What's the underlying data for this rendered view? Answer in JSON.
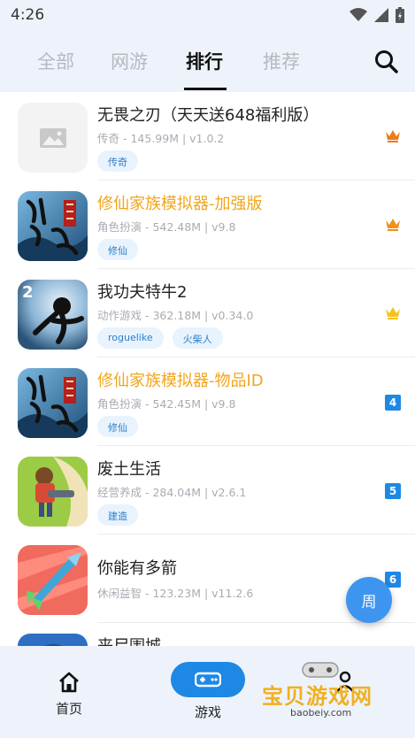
{
  "status_bar": {
    "time": "4:26"
  },
  "tabs": [
    {
      "label": "全部",
      "active": false
    },
    {
      "label": "网游",
      "active": false
    },
    {
      "label": "排行",
      "active": true
    },
    {
      "label": "推荐",
      "active": false
    }
  ],
  "apps": [
    {
      "name": "无畏之刃（天天送648福利版）",
      "meta": "传奇 - 145.99M | v1.0.2",
      "tags": [
        "传奇"
      ],
      "rank": "crown",
      "highlight": false,
      "icon": "image-placeholder-icon"
    },
    {
      "name": "修仙家族模拟器-加强版",
      "meta": "角色扮演 - 542.48M | v9.8",
      "tags": [
        "修仙"
      ],
      "rank": "crown",
      "highlight": true,
      "icon": "xiuxian-game-icon"
    },
    {
      "name": "我功夫特牛2",
      "meta": "动作游戏 - 362.18M | v0.34.0",
      "tags": [
        "roguelike",
        "火柴人"
      ],
      "rank": "crown",
      "highlight": false,
      "icon": "kungfu-game-icon"
    },
    {
      "name": "修仙家族模拟器-物品ID",
      "meta": "角色扮演 - 542.45M | v9.8",
      "tags": [
        "修仙"
      ],
      "rank": "4",
      "highlight": true,
      "icon": "xiuxian-game-icon"
    },
    {
      "name": "废土生活",
      "meta": "经营养成 - 284.04M | v2.6.1",
      "tags": [
        "建造"
      ],
      "rank": "5",
      "highlight": false,
      "icon": "wasteland-game-icon"
    },
    {
      "name": "你能有多箭",
      "meta": "休闲益智 - 123.23M | v11.2.6",
      "tags": [],
      "rank": "6",
      "highlight": false,
      "icon": "arrow-game-icon"
    },
    {
      "name": "丧尸围城",
      "meta": "",
      "tags": [],
      "rank": "",
      "highlight": false,
      "icon": "zombie-game-icon"
    }
  ],
  "fab": {
    "label": "周"
  },
  "nav": {
    "home": "首页",
    "games": "游戏"
  },
  "watermark": {
    "text": "宝贝游戏网",
    "url": "baobeiy.com"
  },
  "colors": {
    "accent": "#1e88e5",
    "highlight": "#f0a51c",
    "crown": "#f5a623",
    "header_bg": "#eef3fb"
  }
}
